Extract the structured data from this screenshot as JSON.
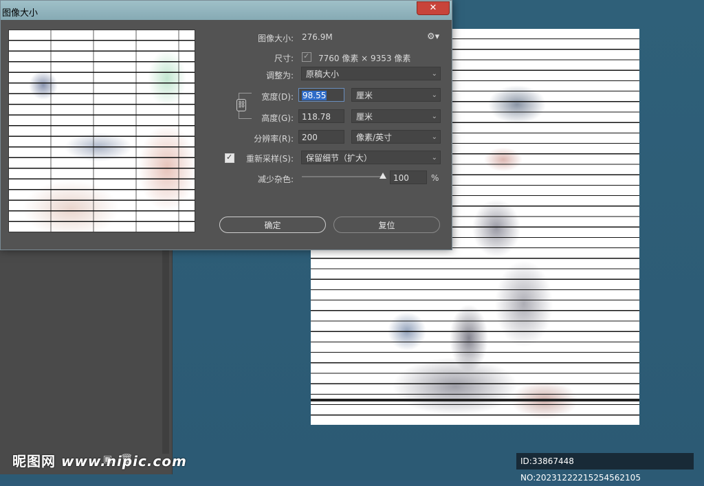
{
  "dialog": {
    "title": "图像大小",
    "close_symbol": "✕",
    "image_size": {
      "label": "图像大小:",
      "value": "276.9M"
    },
    "dimensions": {
      "label": "尺寸:",
      "value": "7760 像素 × 9353 像素"
    },
    "fit_to": {
      "label": "调整为:",
      "selected": "原稿大小"
    },
    "width": {
      "label": "宽度(D):",
      "value": "98.55",
      "unit": "厘米"
    },
    "height": {
      "label": "高度(G):",
      "value": "118.78",
      "unit": "厘米"
    },
    "resolution": {
      "label": "分辨率(R):",
      "value": "200",
      "unit": "像素/英寸"
    },
    "resample": {
      "label": "重新采样(S):",
      "checked": true,
      "selected": "保留细节（扩大）"
    },
    "reduce_noise": {
      "label": "减少杂色:",
      "value": "100",
      "unit": "%",
      "level": 1.0
    },
    "ok_label": "确定",
    "reset_label": "复位"
  },
  "watermark": {
    "brand": "昵图网",
    "url": "www.nipic.com"
  },
  "id_tag": "ID:33867448 NO:20231222215254562105",
  "icons": {
    "settings": "gear-icon",
    "link": "chain-link-icon",
    "close": "close-icon"
  }
}
